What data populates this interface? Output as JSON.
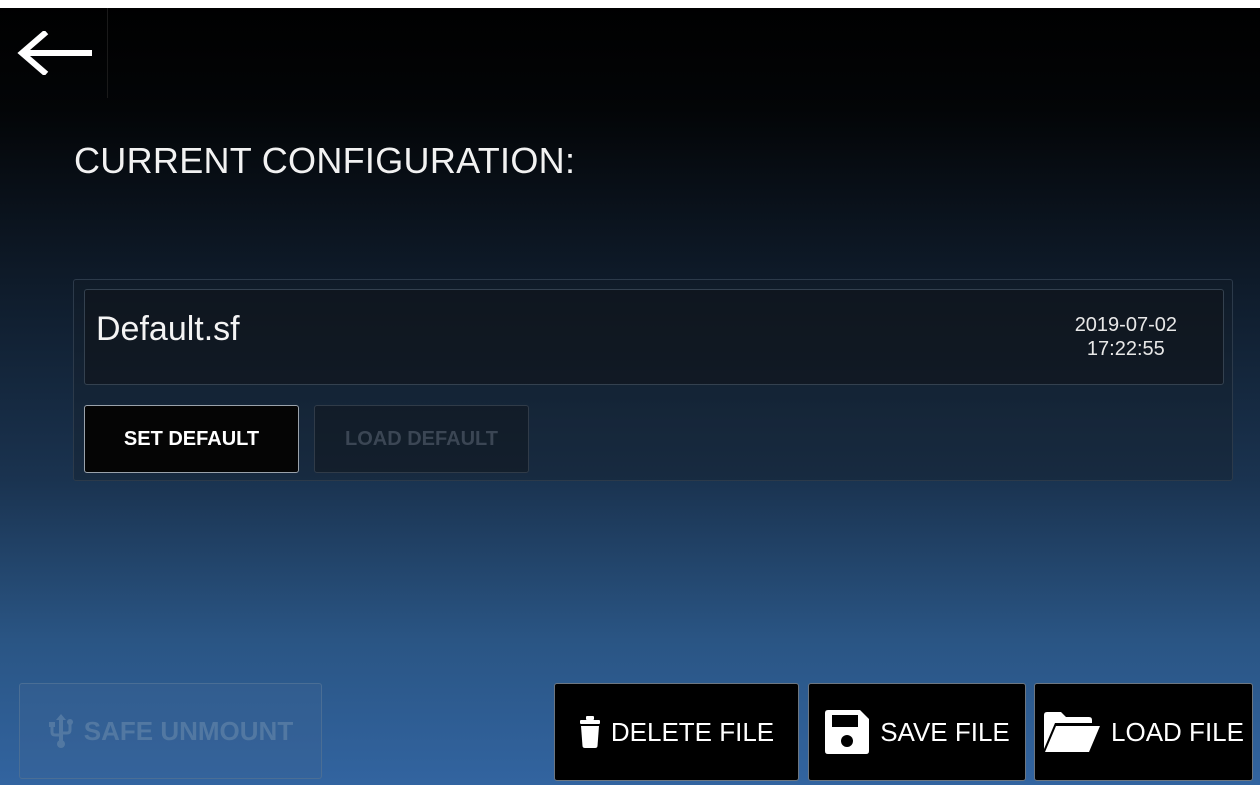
{
  "header": {
    "back_icon": "arrow-left-icon"
  },
  "page": {
    "title": "CURRENT CONFIGURATION:"
  },
  "current_file": {
    "name": "Default.sf",
    "date": "2019-07-02",
    "time": "17:22:55"
  },
  "config_actions": {
    "set_default_label": "SET DEFAULT",
    "load_default_label": "LOAD DEFAULT",
    "load_default_enabled": false
  },
  "bottom_bar": {
    "safe_unmount": {
      "label": "SAFE UNMOUNT",
      "icon": "usb-icon",
      "enabled": false
    },
    "delete_file": {
      "label": "DELETE FILE",
      "icon": "trash-icon"
    },
    "save_file": {
      "label": "SAVE FILE",
      "icon": "floppy-disk-icon"
    },
    "load_file": {
      "label": "LOAD FILE",
      "icon": "folder-open-icon"
    }
  },
  "colors": {
    "accent_border": "#9aa2ab",
    "disabled_text": "#3b4654",
    "disabled_unmount_text": "#5278a2",
    "background_bottom": "#3264a0"
  }
}
